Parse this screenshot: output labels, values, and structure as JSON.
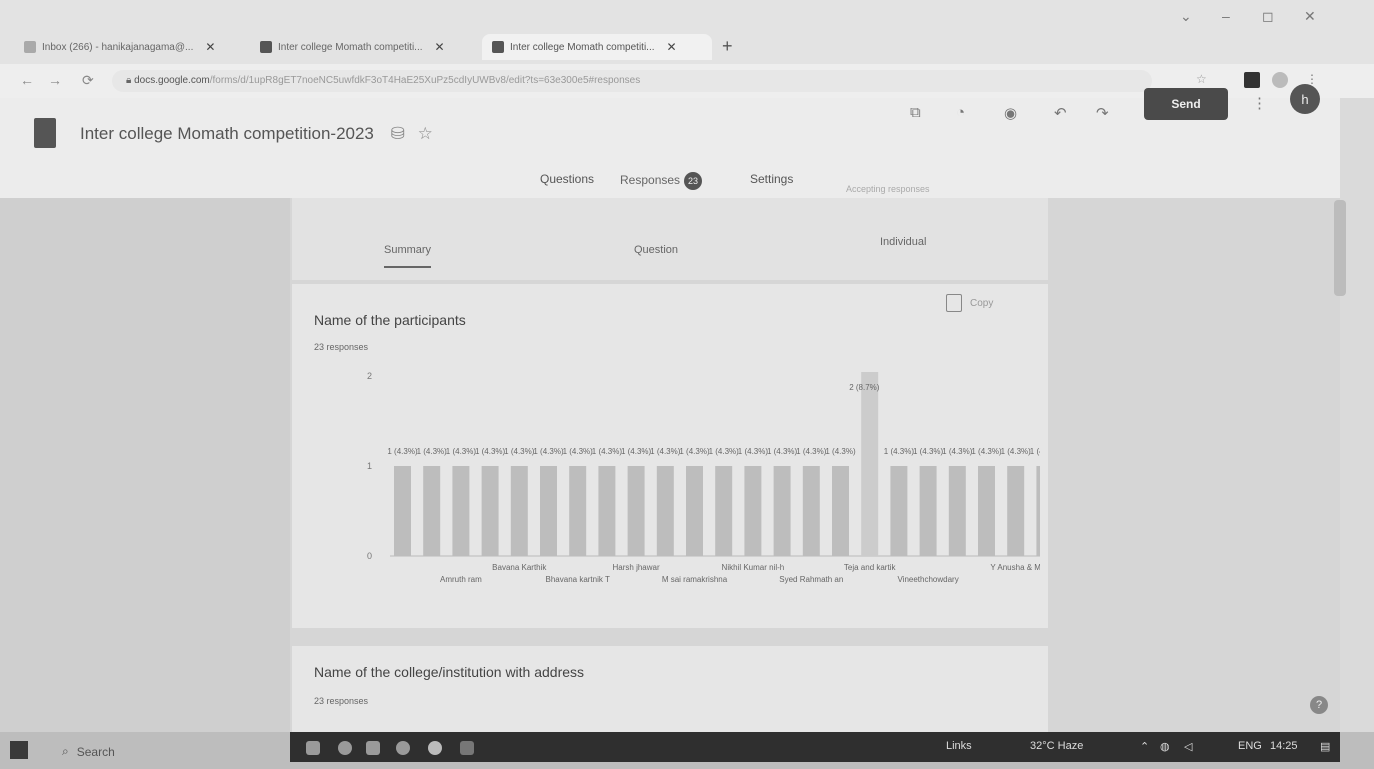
{
  "browser": {
    "tabs": [
      {
        "title": "Inbox (266) - hanikajanagama@...",
        "active": false
      },
      {
        "title": "Inter college Momath competiti...",
        "active": false
      },
      {
        "title": "Inter college Momath competiti...",
        "active": true
      }
    ],
    "new_tab": "+",
    "url_host": "docs.google.com",
    "url_rest": "/forms/d/1upR8gET7noeNC5uwfdkF3oT4HaE25XuPz5cdIyUWBv8/edit?ts=63e300e5#responses",
    "window_controls": [
      "⌄",
      "–",
      "◻",
      "✕"
    ]
  },
  "form": {
    "title": "Inter college Momath competition-2023",
    "send_label": "Send",
    "avatar_letter": "h",
    "nav": {
      "questions": "Questions",
      "responses": "Responses",
      "responses_count": "23",
      "settings": "Settings"
    },
    "accepting": "Accepting responses"
  },
  "summary_tabs": {
    "summary": "Summary",
    "question": "Question",
    "individual": "Individual"
  },
  "question1": {
    "title": "Name of the participants",
    "responses": "23 responses",
    "copy_label": "Copy"
  },
  "question2": {
    "title": "Name of the college/institution with address",
    "responses": "23 responses"
  },
  "chart_data": {
    "type": "bar",
    "y_ticks": [
      "0",
      "1",
      "2"
    ],
    "ylim": [
      0,
      2
    ],
    "values": [
      1,
      1,
      1,
      1,
      1,
      1,
      1,
      1,
      1,
      1,
      1,
      1,
      1,
      1,
      1,
      1,
      2,
      1,
      1,
      1,
      1,
      1,
      1
    ],
    "data_labels": [
      "1 (4.3%)",
      "1 (4.3%)",
      "1 (4.3%)",
      "1 (4.3%)",
      "1 (4.3%)",
      "1 (4.3%)",
      "1 (4.3%)",
      "1 (4.3%)",
      "1 (4.3%)",
      "1 (4.3%)",
      "1 (4.3%)",
      "1 (4.3%)",
      "1 (4.3%)",
      "1 (4.3%)",
      "1 (4.3%)",
      "1 (4.3%)",
      "2 (8.7%)",
      "1 (4.3%)",
      "1 (4.3%)",
      "1 (4.3%)",
      "1 (4.3%)",
      "1 (4.3%)",
      "1 (4.3%)"
    ],
    "x_labels_top": [
      "Bavana Karthik",
      "Harsh jhawar",
      "Nikhil Kumar nil-h",
      "Teja and kartik",
      "Y Anusha & M"
    ],
    "x_labels_bottom": [
      "Amruth ram",
      "Bhavana kartnik T",
      "M sai ramakrishna",
      "Syed Rahmath an",
      "Vineethchowdary"
    ],
    "grid": false
  },
  "taskbar": {
    "search": "Search",
    "links": "Links",
    "weather": "32°C Haze",
    "lang": "ENG",
    "time": "14:25"
  },
  "colors": {
    "bar": "#bdbdbd",
    "bar_highlight": "#cccccc",
    "send_button": "#4a4a4a"
  }
}
